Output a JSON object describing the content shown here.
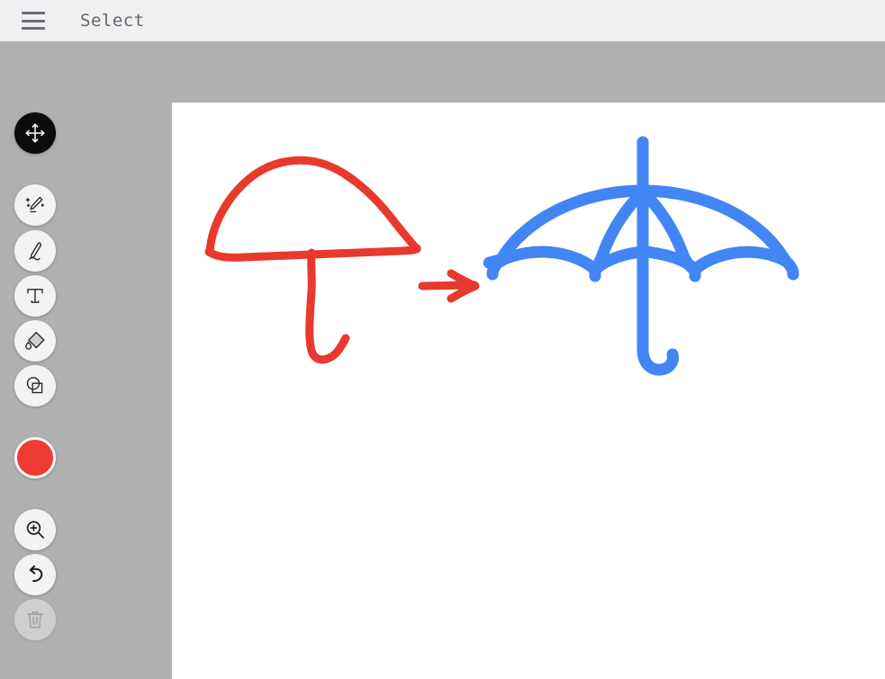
{
  "app": {
    "background_color": "#b0b0b0",
    "canvas_color": "#ffffff"
  },
  "header": {
    "title": "Select",
    "menu_icon": "hamburger-menu-icon",
    "background_color": "#f0f0f2",
    "text_color": "#636669"
  },
  "toolbar": {
    "tools": [
      {
        "name": "move",
        "icon": "move-arrows-icon",
        "label": "Move",
        "active": true,
        "disabled": false
      },
      {
        "name": "magic-draw",
        "icon": "magic-pencil-icon",
        "label": "Magic Draw",
        "active": false,
        "disabled": false
      },
      {
        "name": "pen",
        "icon": "pen-icon",
        "label": "Pen",
        "active": false,
        "disabled": false
      },
      {
        "name": "text",
        "icon": "text-t-icon",
        "label": "Text",
        "active": false,
        "disabled": false
      },
      {
        "name": "fill",
        "icon": "paint-bucket-icon",
        "label": "Fill",
        "active": false,
        "disabled": false
      },
      {
        "name": "shapes",
        "icon": "shapes-icon",
        "label": "Shapes",
        "active": false,
        "disabled": false
      }
    ],
    "color": {
      "name": "color-swatch",
      "label": "Color",
      "value": "#ee3b33"
    },
    "actions": [
      {
        "name": "zoom",
        "icon": "zoom-in-icon",
        "label": "Zoom In",
        "disabled": false
      },
      {
        "name": "undo",
        "icon": "undo-arrow-icon",
        "label": "Undo",
        "disabled": false
      },
      {
        "name": "delete",
        "icon": "trash-icon",
        "label": "Delete",
        "disabled": true
      }
    ]
  },
  "canvas": {
    "name": "drawing-canvas",
    "strokes": [
      {
        "name": "red-umbrella-sketch",
        "color": "#e8392e",
        "description": "Hand-drawn red umbrella sketch",
        "stroke_width": 9
      },
      {
        "name": "red-arrow",
        "color": "#e8392e",
        "description": "Hand-drawn red arrow pointing right",
        "stroke_width": 9
      },
      {
        "name": "blue-umbrella-icon",
        "color": "#4285f4",
        "description": "Generated blue umbrella icon",
        "stroke_width": 13
      }
    ]
  }
}
